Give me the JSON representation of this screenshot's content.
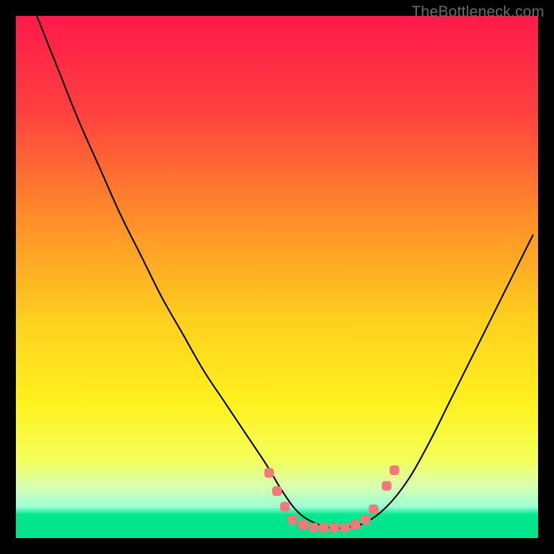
{
  "watermark": "TheBottleneck.com",
  "chart_data": {
    "type": "line",
    "title": "",
    "xlabel": "",
    "ylabel": "",
    "xlim": [
      0,
      100
    ],
    "ylim": [
      0,
      100
    ],
    "background_gradient": {
      "stops": [
        {
          "pos": 0.0,
          "color": "#ff1a4b"
        },
        {
          "pos": 0.18,
          "color": "#ff3f3f"
        },
        {
          "pos": 0.38,
          "color": "#ff8b2a"
        },
        {
          "pos": 0.58,
          "color": "#ffcf1f"
        },
        {
          "pos": 0.74,
          "color": "#fff11e"
        },
        {
          "pos": 0.85,
          "color": "#f4ff5a"
        },
        {
          "pos": 0.9,
          "color": "#d9ffb0"
        },
        {
          "pos": 0.94,
          "color": "#9bffd6"
        },
        {
          "pos": 0.955,
          "color": "#00e88f"
        },
        {
          "pos": 0.97,
          "color": "#00e58d"
        },
        {
          "pos": 1.0,
          "color": "#00e58d"
        }
      ]
    },
    "series": [
      {
        "name": "bottleneck-curve",
        "x": [
          4,
          8,
          12,
          16,
          20,
          24,
          28,
          32,
          36,
          40,
          44,
          48,
          51,
          54,
          57,
          60,
          63,
          67,
          71,
          75,
          79,
          83,
          87,
          91,
          95,
          99
        ],
        "y": [
          100,
          90,
          80,
          71,
          62,
          54,
          46,
          39,
          32,
          26,
          20,
          14,
          9,
          5,
          3,
          2,
          2,
          3,
          6,
          11,
          18,
          26,
          34,
          42,
          50,
          58
        ]
      }
    ],
    "markers": {
      "name": "highlighted-points",
      "color": "#ef7a7a",
      "points": [
        {
          "x": 48.5,
          "y": 12.5
        },
        {
          "x": 50.0,
          "y": 9.0
        },
        {
          "x": 51.5,
          "y": 6.0
        },
        {
          "x": 53.0,
          "y": 3.5
        },
        {
          "x": 55.0,
          "y": 2.5
        },
        {
          "x": 57.0,
          "y": 2.0
        },
        {
          "x": 59.0,
          "y": 2.0
        },
        {
          "x": 61.0,
          "y": 2.0
        },
        {
          "x": 63.0,
          "y": 2.0
        },
        {
          "x": 65.0,
          "y": 2.5
        },
        {
          "x": 67.0,
          "y": 3.5
        },
        {
          "x": 68.5,
          "y": 5.5
        },
        {
          "x": 71.0,
          "y": 10.0
        },
        {
          "x": 72.5,
          "y": 13.0
        }
      ]
    }
  }
}
